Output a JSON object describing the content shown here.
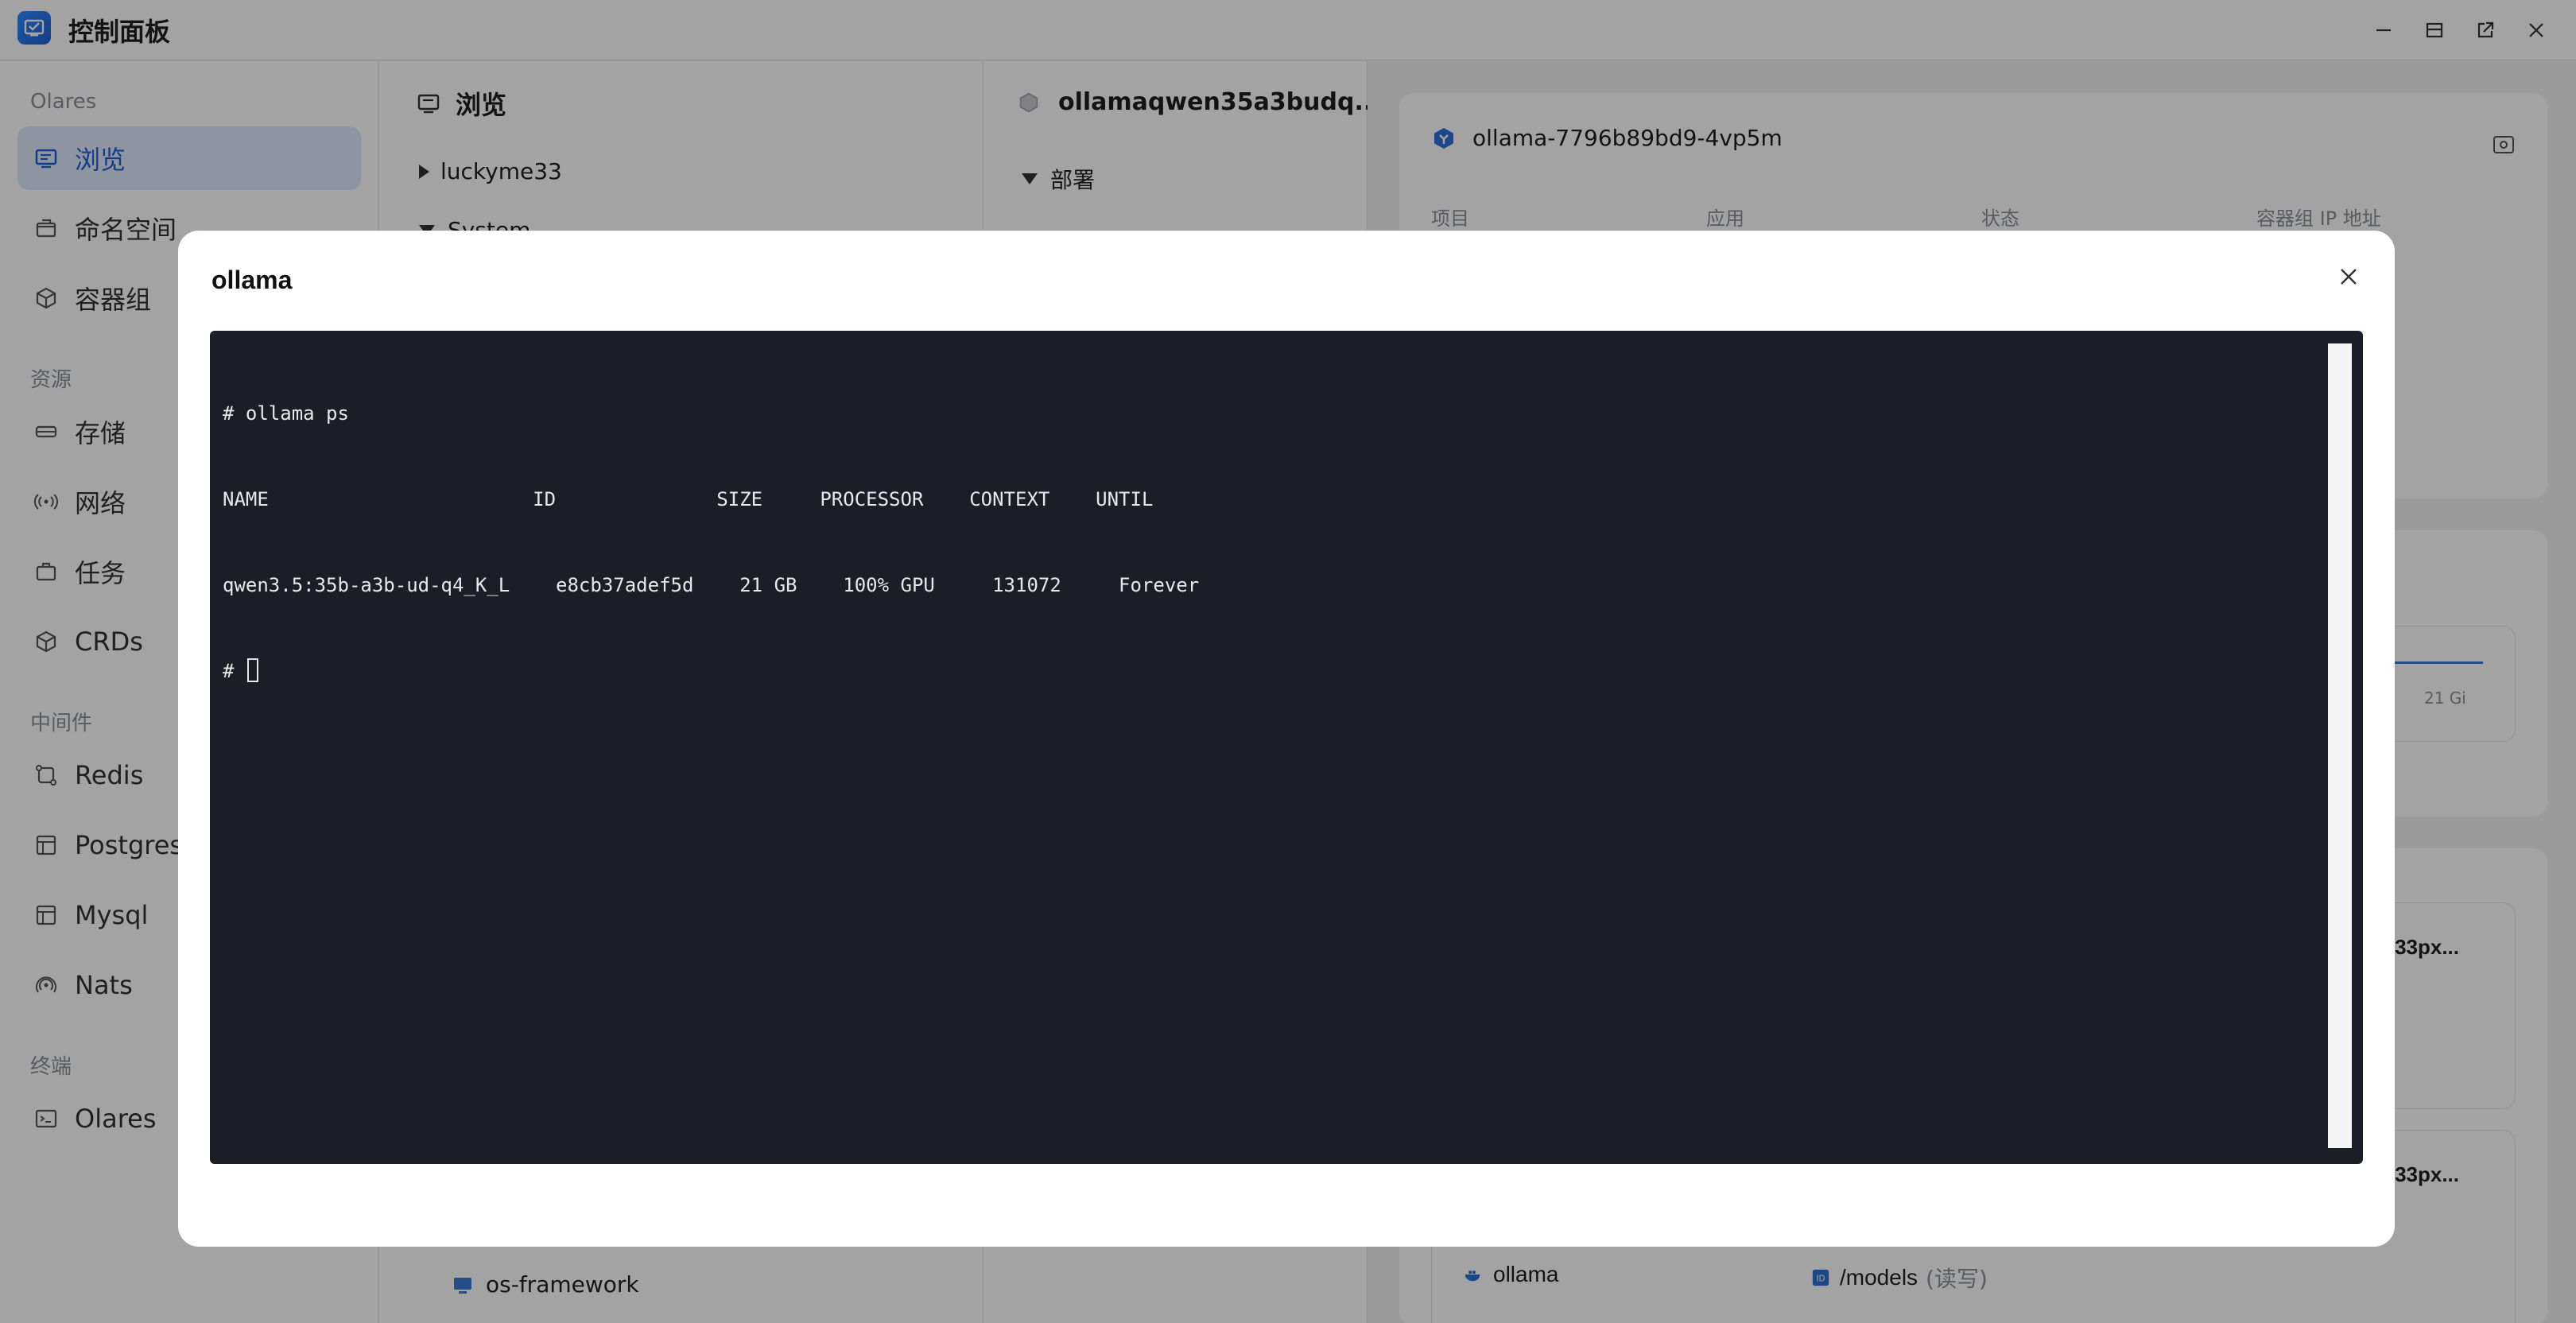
{
  "window": {
    "title": "控制面板"
  },
  "sidebar": {
    "groups": [
      {
        "title": "Olares",
        "items": [
          {
            "label": "浏览",
            "icon": "browse-icon",
            "active": true
          },
          {
            "label": "命名空间",
            "icon": "namespace-icon"
          },
          {
            "label": "容器组",
            "icon": "cube-icon"
          }
        ]
      },
      {
        "title": "资源",
        "items": [
          {
            "label": "存储",
            "icon": "storage-icon"
          },
          {
            "label": "网络",
            "icon": "network-icon"
          },
          {
            "label": "任务",
            "icon": "task-icon"
          },
          {
            "label": "CRDs",
            "icon": "cube-icon"
          }
        ]
      },
      {
        "title": "中间件",
        "items": [
          {
            "label": "Redis",
            "icon": "redis-icon"
          },
          {
            "label": "Postgres",
            "icon": "database-icon"
          },
          {
            "label": "Mysql",
            "icon": "database-icon"
          },
          {
            "label": "Nats",
            "icon": "signal-icon"
          }
        ]
      },
      {
        "title": "终端",
        "items": [
          {
            "label": "Olares",
            "icon": "terminal-icon"
          }
        ]
      }
    ]
  },
  "browse_panel": {
    "title": "浏览",
    "tree": [
      "luckyme33",
      "System"
    ],
    "footer_item": "os-framework"
  },
  "workload_panel": {
    "title": "ollamaqwen35a3budq...",
    "section": "部署"
  },
  "pod_panel": {
    "pod_name": "ollama-7796b89bd9-4vp5m",
    "columns": [
      "项目",
      "应用",
      "状态",
      "容器组 IP 地址"
    ],
    "chart_label": "21 Gi",
    "truncated_label_1": "33px...",
    "truncated_label_2": "33px...",
    "container_name": "ollama",
    "mount_path": "/models",
    "mount_mode": "(读写)"
  },
  "dialog": {
    "title": "ollama",
    "terminal": {
      "command_line": "# ollama ps",
      "header_line": "NAME                       ID              SIZE     PROCESSOR    CONTEXT    UNTIL",
      "row_line": "qwen3.5:35b-a3b-ud-q4_K_L    e8cb37adef5d    21 GB    100% GPU     131072     Forever",
      "prompt": "# "
    }
  },
  "colors": {
    "accent": "#1d5ed8",
    "active_bg": "#dfe9fb",
    "terminal_bg": "#1b1e27",
    "terminal_fg": "#e8e8e8"
  }
}
